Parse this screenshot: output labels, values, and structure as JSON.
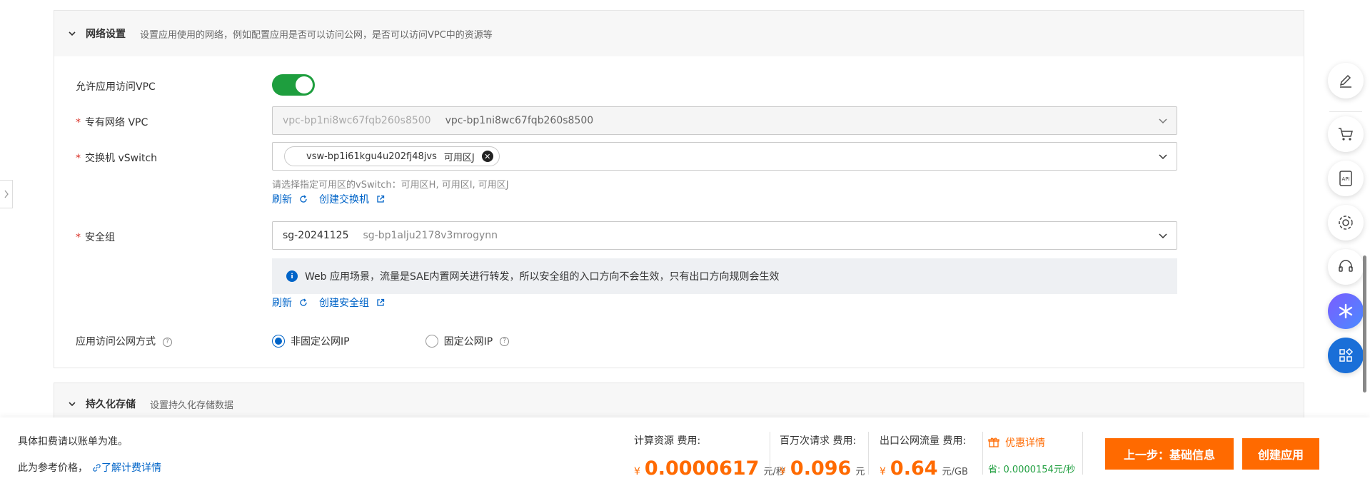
{
  "network": {
    "title": "网络设置",
    "desc": "设置应用使用的网络，例如配置应用是否可以访问公网，是否可以访问VPC中的资源等",
    "allow_vpc_label": "允许应用访问VPC",
    "allow_vpc_on": true,
    "vpc_label": "专有网络 VPC",
    "vpc_value_1": "vpc-bp1ni8wc67fqb260s8500",
    "vpc_value_2": "vpc-bp1ni8wc67fqb260s8500",
    "vswitch_label": "交换机 vSwitch",
    "vswitch_tag": "vsw-bp1i61kgu4u202fj48jvs",
    "vswitch_zone": "可用区J",
    "vswitch_hint": "请选择指定可用区的vSwitch：可用区H, 可用区I, 可用区J",
    "refresh_label": "刷新",
    "create_vswitch_label": "创建交换机",
    "sg_label": "安全组",
    "sg_name": "sg-20241125",
    "sg_id": "sg-bp1alju2178v3mrogynn",
    "notice": "Web 应用场景，流量是SAE内置网关进行转发，所以安全组的入口方向不会生效，只有出口方向规则会生效",
    "refresh_label_2": "刷新",
    "create_sg_label": "创建安全组",
    "public_access_label": "应用访问公网方式",
    "radio_option_1": "非固定公网IP",
    "radio_option_2": "固定公网IP",
    "selected_option": 1
  },
  "storage": {
    "title": "持久化存储",
    "desc": "设置持久化存储数据"
  },
  "footer": {
    "note1": "具体扣费请以账单为准。",
    "note2": "此为参考价格，",
    "pricing_link": "了解计费详情",
    "cost1_label": "计算资源 费用:",
    "cost1_currency": "¥",
    "cost1_value": "0.0000617",
    "cost1_unit": "元/秒",
    "cost2_label": "百万次请求 费用:",
    "cost2_currency": "¥",
    "cost2_value": "0.096",
    "cost2_unit": "元",
    "cost3_label": "出口公网流量 费用:",
    "cost3_currency": "¥",
    "cost3_value": "0.64",
    "cost3_unit": "元/GB",
    "promo_label": "优惠详情",
    "promo_save": "省: 0.0000154元/秒",
    "prev_button": "上一步：基础信息",
    "create_button": "创建应用"
  },
  "icons": [
    "edit-icon",
    "cart-icon",
    "api-icon",
    "settings-icon",
    "support-icon",
    "ai-assistant-icon",
    "apps-grid-icon"
  ],
  "colors": {
    "accent": "#ff6a00",
    "link": "#0064c8",
    "toggle_on": "#1e9e3e"
  }
}
